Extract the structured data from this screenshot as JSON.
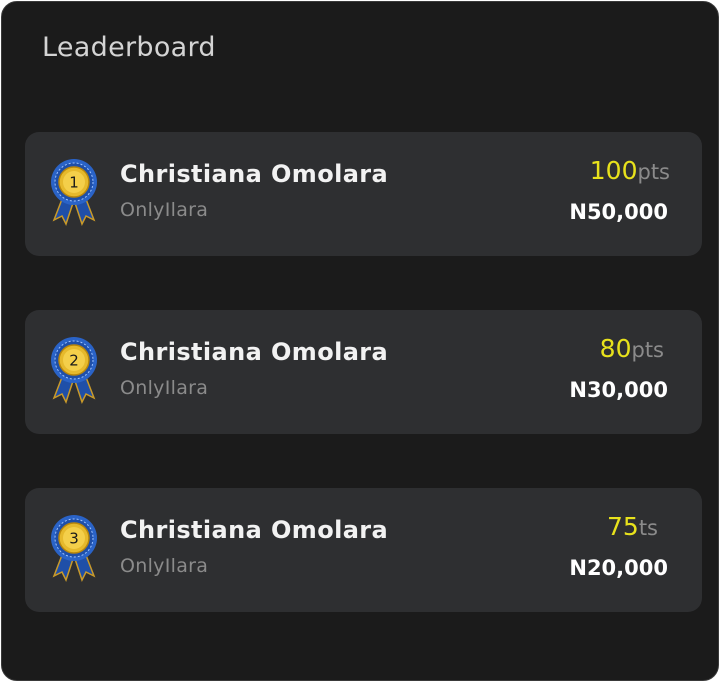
{
  "leaderboard": {
    "title": "Leaderboard",
    "entries": [
      {
        "rank": "1",
        "name": "Christiana Omolara",
        "handle": "OnlyIlara",
        "points": "100",
        "points_unit": "pts",
        "prize": "N50,000"
      },
      {
        "rank": "2",
        "name": "Christiana Omolara",
        "handle": "OnlyIlara",
        "points": "80",
        "points_unit": "pts",
        "prize": "N30,000"
      },
      {
        "rank": "3",
        "name": "Christiana Omolara",
        "handle": "OnlyIlara",
        "points": "75",
        "points_unit": "ts",
        "prize": "N20,000"
      }
    ]
  },
  "colors": {
    "panel_background": "#1b1b1b",
    "card_background": "#2e2f31",
    "points_accent": "#e8e21c",
    "medal_gold": "#e6b92c",
    "ribbon_blue": "#1f4fa8"
  },
  "icons": {
    "medal": "medal-icon"
  }
}
